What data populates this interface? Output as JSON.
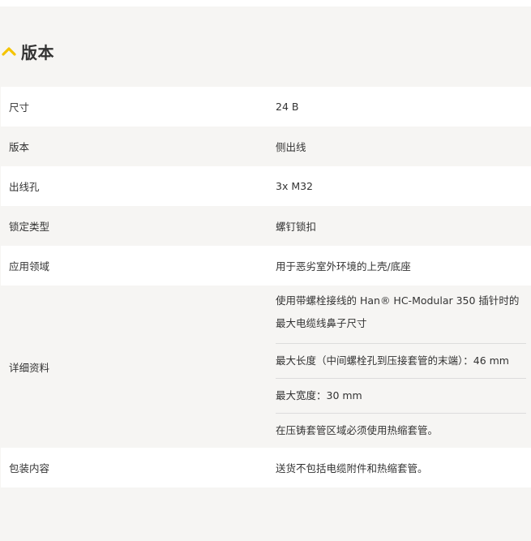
{
  "section": {
    "title": "版本",
    "icon": "chevron-up-icon",
    "accent_color": "#f5c400"
  },
  "rows": [
    {
      "label": "尺寸",
      "value": "24 B"
    },
    {
      "label": "版本",
      "value": "侧出线"
    },
    {
      "label": "出线孔",
      "value": "3x M32"
    },
    {
      "label": "锁定类型",
      "value": "螺钉锁扣"
    },
    {
      "label": "应用领域",
      "value": "用于恶劣室外环境的上壳/底座"
    }
  ],
  "details": {
    "label": "详细资料",
    "items": [
      "使用带螺栓接线的 Han® HC-Modular 350 插针时的最大电缆线鼻子尺寸",
      "最大长度（中间螺栓孔到压接套管的末端）：46 mm",
      "最大宽度：30 mm",
      "在压铸套管区域必须使用热缩套管。"
    ]
  },
  "package": {
    "label": "包装内容",
    "value": "送货不包括电缆附件和热缩套管。"
  }
}
